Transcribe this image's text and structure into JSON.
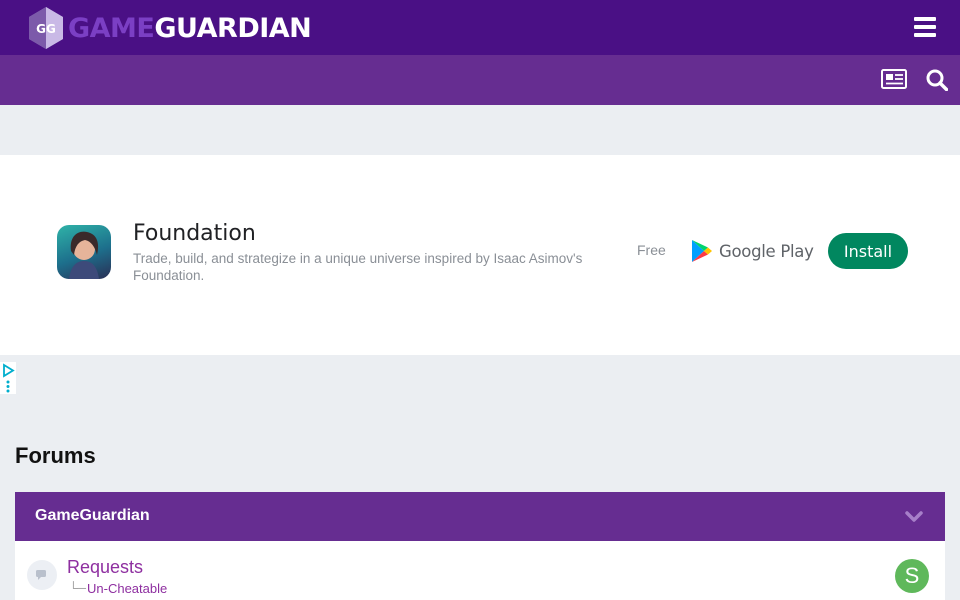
{
  "header": {
    "logo_text_part1": "GAME",
    "logo_text_part2": "GUARDIAN",
    "logo_badge_letters": "GG",
    "menu_icon": "hamburger-menu-icon"
  },
  "subnav": {
    "icons": [
      "newspaper-icon",
      "search-icon"
    ]
  },
  "ad": {
    "app_name": "Foundation",
    "description": "Trade, build, and strategize in a unique universe inspired by Isaac Asimov's Foundation.",
    "price": "Free",
    "store_label": "Google Play",
    "install_label": "Install",
    "adchoices_icon": "adchoices-icon"
  },
  "forums": {
    "title": "Forums",
    "categories": [
      {
        "name": "GameGuardian",
        "forums": [
          {
            "name": "Requests",
            "subforum_branch": "└─",
            "subforums": [
              "Un-Cheatable"
            ],
            "last_poster_initial": "S"
          }
        ]
      }
    ]
  },
  "colors": {
    "topbar": "#4a1085",
    "subbar": "#662d91",
    "category_header": "#662d91",
    "link": "#8e2fa0",
    "install_button": "#01875f",
    "avatar": "#5fb85b",
    "page_bg": "#ebeef2"
  }
}
